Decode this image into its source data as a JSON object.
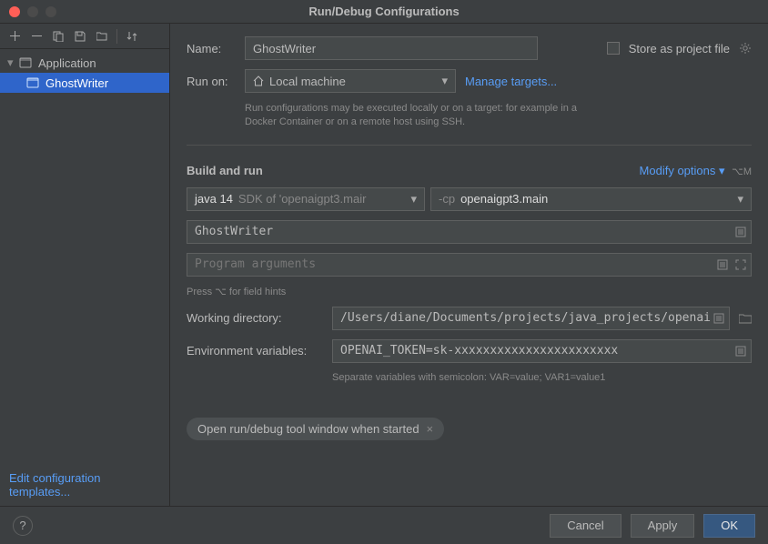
{
  "window": {
    "title": "Run/Debug Configurations"
  },
  "sidebar": {
    "nodes": [
      {
        "label": "Application",
        "expanded": true
      },
      {
        "label": "GhostWriter",
        "selected": true
      }
    ],
    "edit_templates": "Edit configuration templates..."
  },
  "form": {
    "name_label": "Name:",
    "name_value": "GhostWriter",
    "store_checkbox_label": "Store as project file",
    "run_on_label": "Run on:",
    "run_on_value": "Local machine",
    "manage_targets": "Manage targets...",
    "run_on_hint": "Run configurations may be executed locally or on a target: for example in a Docker Container or on a remote host using SSH.",
    "build_run_title": "Build and run",
    "modify_options": "Modify options",
    "modify_shortcut": "⌥M",
    "jdk_text": "java 14",
    "jdk_hint": "SDK of 'openaigpt3.mair",
    "cp_prefix": "-cp",
    "cp_value": "openaigpt3.main",
    "main_class": "GhostWriter",
    "program_args_placeholder": "Program arguments",
    "field_hints": "Press ⌥ for field hints",
    "wd_label": "Working directory:",
    "wd_value": "/Users/diane/Documents/projects/java_projects/openai",
    "env_label": "Environment variables:",
    "env_value": "OPENAI_TOKEN=sk-xxxxxxxxxxxxxxxxxxxxxxx",
    "env_hint": "Separate variables with semicolon: VAR=value; VAR1=value1",
    "tag_label": "Open run/debug tool window when started"
  },
  "footer": {
    "cancel": "Cancel",
    "apply": "Apply",
    "ok": "OK"
  }
}
